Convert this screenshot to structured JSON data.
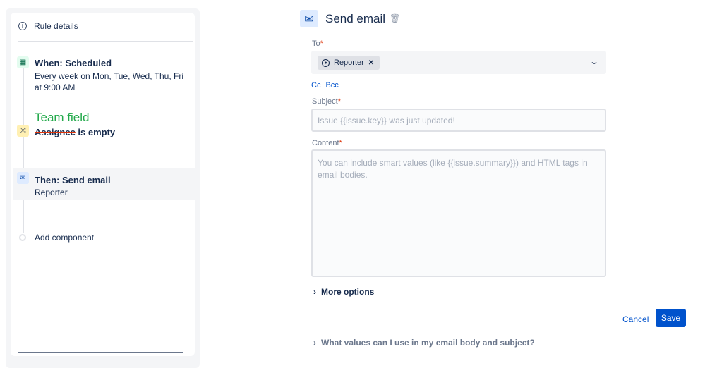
{
  "sidebar": {
    "rule_details": "Rule details",
    "trigger": {
      "title": "When: Scheduled",
      "subtitle": "Every week on Mon, Tue, Wed, Thu, Fri at 9:00 AM"
    },
    "condition": {
      "annotation": "Team field",
      "struck": "Assignee",
      "rest": " is empty"
    },
    "action": {
      "title": "Then: Send email",
      "subtitle": "Reporter"
    },
    "add_component": "Add component"
  },
  "main": {
    "title": "Send email",
    "to_label": "To",
    "required_mark": "*",
    "to_chip": "Reporter",
    "cc": "Cc",
    "bcc": "Bcc",
    "subject_label": "Subject",
    "subject_placeholder": "Issue {{issue.key}} was just updated!",
    "content_label": "Content",
    "content_placeholder": "You can include smart values (like {{issue.summary}}) and HTML tags in email bodies.",
    "more_options": "More options",
    "cancel": "Cancel",
    "save": "Save",
    "help": "What values can I use in my email body and subject?"
  },
  "colors": {
    "accent": "#0052cc",
    "annotation": "#22a94a",
    "required": "#de350b"
  }
}
